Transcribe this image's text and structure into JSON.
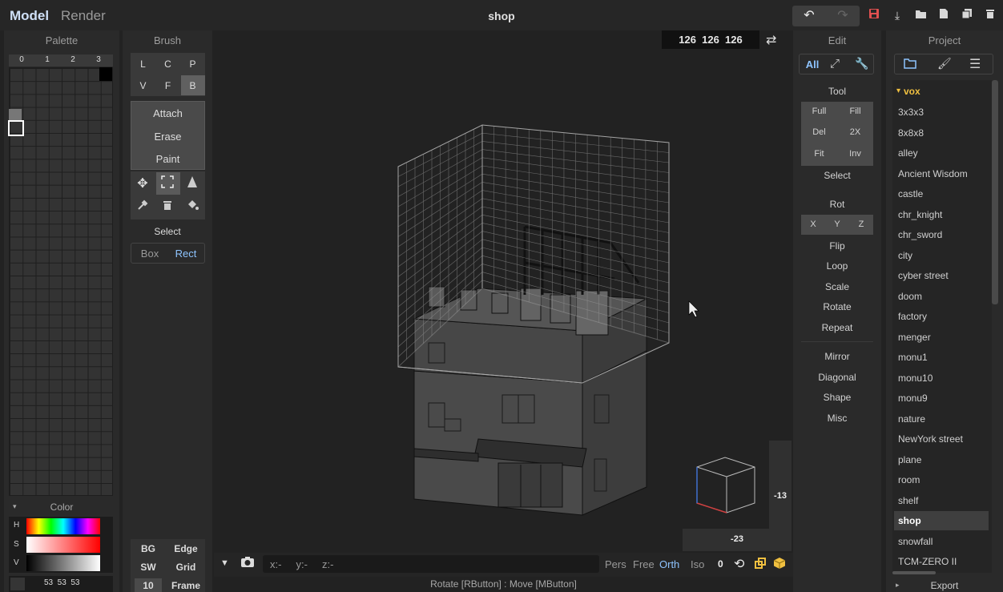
{
  "topbar": {
    "model": "Model",
    "render": "Render",
    "title": "shop"
  },
  "icons": {
    "undo": "undo-icon",
    "redo": "redo-icon",
    "save": "save-icon",
    "download": "download-icon",
    "open": "folder-open-icon",
    "new": "file-icon",
    "copy": "copy-icon",
    "delete": "trash-icon"
  },
  "palette": {
    "title": "Palette",
    "tabs": [
      "0",
      "1",
      "2",
      "3"
    ],
    "color_label": "Color",
    "hsv": [
      "H",
      "S",
      "V"
    ],
    "rgb": "53  53  53"
  },
  "brush": {
    "title": "Brush",
    "row1": [
      "L",
      "C",
      "P"
    ],
    "row2": [
      "V",
      "F",
      "B"
    ],
    "modes": [
      "Attach",
      "Erase",
      "Paint"
    ],
    "select_label": "Select",
    "select_modes": [
      "Box",
      "Rect"
    ]
  },
  "viewport": {
    "dims": "126  126  126",
    "pos_x": "-13",
    "pos_y": "-23",
    "coords": "x:-     y:-     z:-",
    "views": [
      "Pers",
      "Free",
      "Orth",
      "Iso"
    ],
    "zero": "0",
    "status": "Rotate [RButton] : Move [MButton]"
  },
  "bottom_left": {
    "bg": "BG",
    "edge": "Edge",
    "sw": "SW",
    "grid": "Grid",
    "num": "10",
    "frame": "Frame"
  },
  "edit": {
    "title": "Edit",
    "tabs": [
      "All"
    ],
    "tool_label": "Tool",
    "tool_btns": [
      "Full",
      "Fill",
      "Del",
      "2X",
      "Fit",
      "Inv"
    ],
    "select_label": "Select",
    "rot_label": "Rot",
    "axes": [
      "X",
      "Y",
      "Z"
    ],
    "actions": [
      "Flip",
      "Loop",
      "Scale",
      "Rotate",
      "Repeat",
      "Mirror",
      "Diagonal",
      "Shape",
      "Misc"
    ]
  },
  "project": {
    "title": "Project",
    "folder": "vox",
    "items": [
      "3x3x3",
      "8x8x8",
      "alley",
      "Ancient Wisdom",
      "castle",
      "chr_knight",
      "chr_sword",
      "city",
      "cyber street",
      "doom",
      "factory",
      "menger",
      "monu1",
      "monu10",
      "monu9",
      "nature",
      "NewYork street",
      "plane",
      "room",
      "shelf",
      "shop",
      "snowfall",
      "TCM-ZERO II"
    ],
    "selected": "shop",
    "export": "Export"
  },
  "colors": {
    "accent": "#4da3ff",
    "bg": "#222222",
    "panel": "#2a2a2a",
    "save": "#e05050",
    "folder": "#f0c040"
  }
}
